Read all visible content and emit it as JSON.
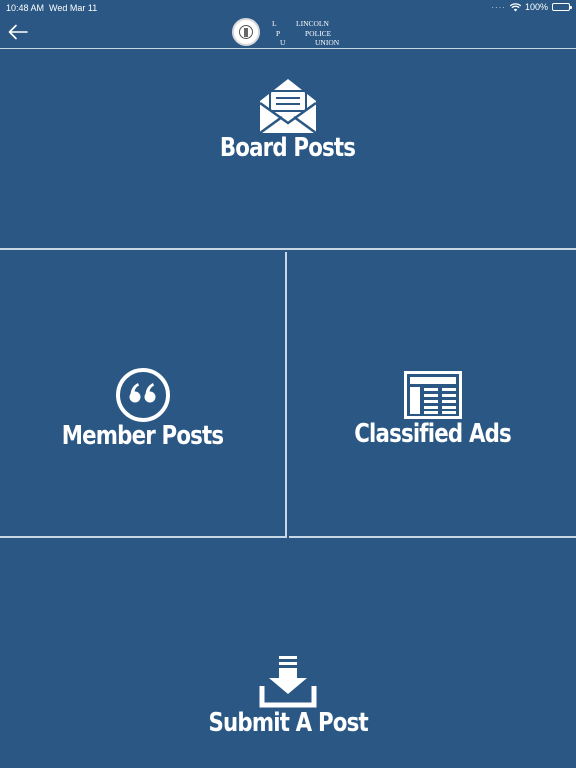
{
  "status_bar": {
    "time": "10:48 AM",
    "date": "Wed Mar 11",
    "battery": "100%",
    "icons": [
      "signal-dots-icon",
      "wifi-icon",
      "battery-icon"
    ]
  },
  "nav": {
    "back_icon": "arrow-left-icon",
    "logo": {
      "initials": [
        "L",
        "P",
        "U"
      ],
      "words": [
        "LINCOLN",
        "POLICE",
        "UNION"
      ]
    }
  },
  "tiles": {
    "board_posts": {
      "label": "Board Posts",
      "icon": "envelope-open-icon"
    },
    "member_posts": {
      "label": "Member Posts",
      "icon": "quote-icon"
    },
    "classified_ads": {
      "label": "Classified Ads",
      "icon": "newspaper-icon"
    },
    "submit_post": {
      "label": "Submit A Post",
      "icon": "download-tray-icon"
    }
  },
  "colors": {
    "background": "#2a5784",
    "divider": "#c9d6e3",
    "foreground": "#ffffff"
  }
}
